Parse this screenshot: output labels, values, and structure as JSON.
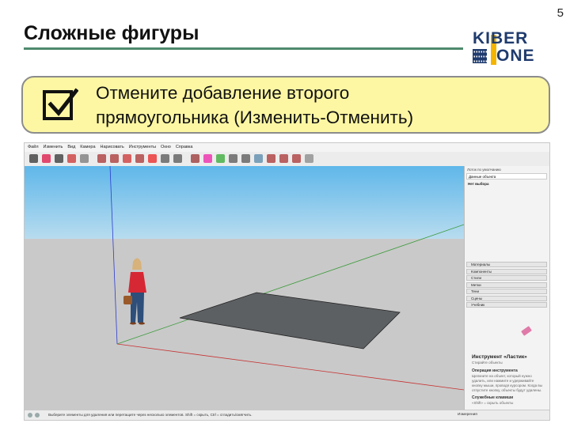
{
  "slide": {
    "number": "5",
    "title": "Сложные фигуры",
    "instruction_line1": "Отмените добавление второго",
    "instruction_line2": "прямоугольника (Изменить-Отменить)"
  },
  "logo": {
    "row1": "KIBER",
    "row2": "ONE",
    "accent": "#f4b400",
    "brand": "#1f3b6e"
  },
  "app": {
    "menu": [
      "Файл",
      "Изменить",
      "Вид",
      "Камера",
      "Нарисовать",
      "Инструменты",
      "Окно",
      "Справка"
    ],
    "tray": {
      "header": "Лоток по умолчанию",
      "entity_info": "Данные объекта",
      "no_selection": "Нет выбора",
      "panels": [
        "Материалы",
        "Компоненты",
        "Стили",
        "Метки",
        "Тени",
        "Сцены",
        "Учебник"
      ],
      "eraser_title": "Инструмент «Ластик»",
      "eraser_sub": "Стирайте объекты",
      "op_title": "Операция инструмента",
      "op_desc": "Щелкните на объект, который нужно удалить, или нажмите и удерживайте кнопку мыши, проводя курсором. Когда вы отпустите кнопку, объекты будут удалены.",
      "keys_title": "Служебные клавиши",
      "keys_desc": "«Shift» = скрыть объекты"
    },
    "status": {
      "message": "Выберите элементы для удаления или перетащите через несколько элементов. Shift = скрыть, Ctrl = сгладить/смягчить.",
      "measure_label": "Измерения"
    },
    "colors": {
      "sky": "#5fb7ea",
      "ground": "#c9c9c9",
      "rectangle": "#5d6063"
    },
    "icons": [
      "select-icon",
      "eraser-icon",
      "line-icon",
      "arc-icon",
      "rectangle-icon",
      "push-pull-icon",
      "move-icon",
      "rotate-icon",
      "scale-icon",
      "offset-icon",
      "tape-measure-icon",
      "text-icon",
      "axes-icon",
      "paint-icon",
      "orbit-icon",
      "pan-icon",
      "zoom-icon",
      "zoom-extents-icon",
      "warehouse-icon",
      "extension-icon",
      "layout-icon",
      "settings-icon"
    ]
  }
}
